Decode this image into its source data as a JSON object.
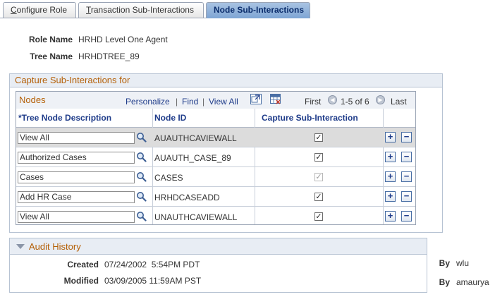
{
  "tabs": [
    {
      "label": "Configure Role",
      "underline": "C",
      "rest": "onfigure Role"
    },
    {
      "label": "Transaction Sub-Interactions",
      "underline": "T",
      "rest": "ransaction Sub-Interactions"
    },
    {
      "label": "Node Sub-Interactions",
      "active": true
    }
  ],
  "header": {
    "role_name_label": "Role Name",
    "role_name_value": "HRHD Level One Agent",
    "tree_name_label": "Tree Name",
    "tree_name_value": "HRHDTREE_89"
  },
  "groupbox": {
    "title": "Capture Sub-Interactions for"
  },
  "grid": {
    "title": "Nodes",
    "personalize": "Personalize",
    "find": "Find",
    "view_all": "View All",
    "sep": "|",
    "first": "First",
    "range": "1-5 of 6",
    "last": "Last",
    "columns": [
      "*Tree Node Description",
      "Node ID",
      "Capture Sub-Interaction"
    ],
    "rows": [
      {
        "description": "View All",
        "node_id": "AUAUTHCAVIEWALL",
        "checked": true,
        "disabled": false
      },
      {
        "description": "Authorized Cases",
        "node_id": "AUAUTH_CASE_89",
        "checked": true,
        "disabled": false
      },
      {
        "description": "Cases",
        "node_id": "CASES",
        "checked": true,
        "disabled": true
      },
      {
        "description": "Add HR Case",
        "node_id": "HRHDCASEADD",
        "checked": true,
        "disabled": false
      },
      {
        "description": "View All",
        "node_id": "UNAUTHCAVIEWALL",
        "checked": true,
        "disabled": false
      }
    ],
    "add_glyph": "+",
    "remove_glyph": "−",
    "check_glyph": "✓"
  },
  "audit": {
    "title": "Audit History",
    "created_label": "Created",
    "created_value": "07/24/2002  5:54PM PDT",
    "modified_label": "Modified",
    "modified_value": "03/09/2005 11:59AM PST",
    "by_label": "By",
    "created_by": "wlu",
    "modified_by": "amaurya"
  },
  "icons": {
    "lookup": "magnifier-icon",
    "prev": "chevron-left-icon",
    "next": "chevron-right-icon",
    "zoom": "zoom-grid-icon",
    "download": "download-grid-icon",
    "collapse": "triangle-down-icon"
  },
  "colors": {
    "accent": "#b45f06",
    "link": "#1f3c8a",
    "active_tab": "#7ea5d4",
    "row_highlight": "#dcdcdc"
  }
}
